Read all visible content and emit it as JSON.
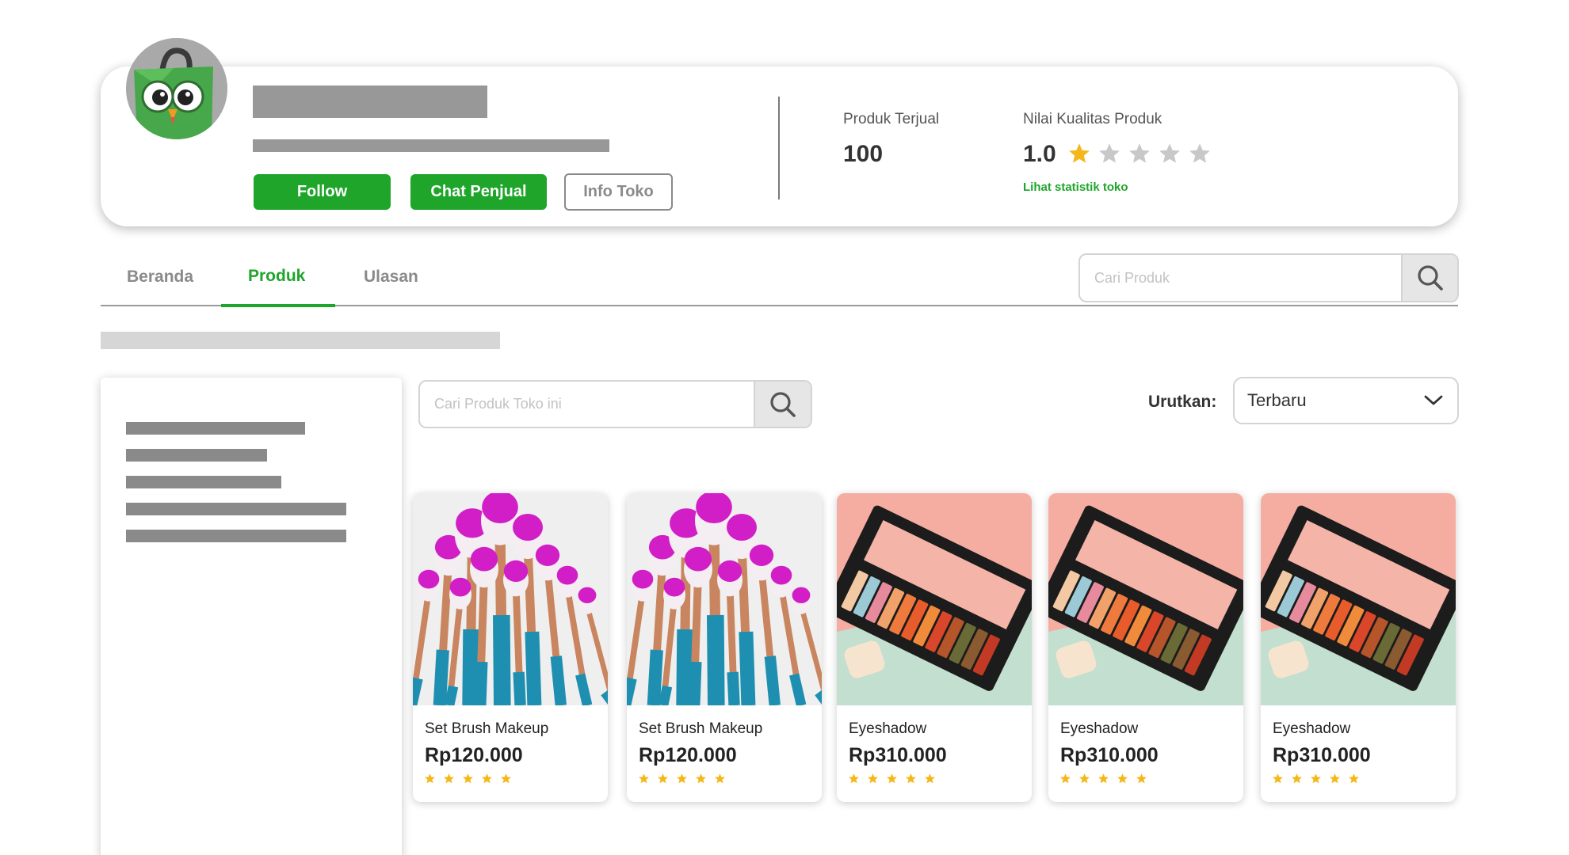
{
  "header": {
    "follow_label": "Follow",
    "chat_label": "Chat Penjual",
    "info_label": "Info Toko",
    "sold_label": "Produk Terjual",
    "sold_value": "100",
    "quality_label": "Nilai Kualitas Produk",
    "quality_value": "1.0",
    "quality_stars_filled": 1,
    "quality_stars_total": 5,
    "stats_link": "Lihat statistik toko"
  },
  "tabs": [
    {
      "label": "Beranda",
      "active": false
    },
    {
      "label": "Produk",
      "active": true
    },
    {
      "label": "Ulasan",
      "active": false
    }
  ],
  "search": {
    "placeholder": "Cari Produk",
    "icon": "search-icon"
  },
  "store_search": {
    "placeholder": "Cari Produk Toko ini",
    "icon": "search-icon"
  },
  "sort": {
    "label": "Urutkan:",
    "value": "Terbaru",
    "icon": "chevron-down-icon"
  },
  "products": [
    {
      "name": "Set Brush Makeup",
      "price": "Rp120.000",
      "rating": 5,
      "image": "makeup-brush-image"
    },
    {
      "name": "Set Brush Makeup",
      "price": "Rp120.000",
      "rating": 5,
      "image": "makeup-brush-image"
    },
    {
      "name": "Eyeshadow",
      "price": "Rp310.000",
      "rating": 5,
      "image": "eyeshadow-palette-image"
    },
    {
      "name": "Eyeshadow",
      "price": "Rp310.000",
      "rating": 5,
      "image": "eyeshadow-palette-image"
    },
    {
      "name": "Eyeshadow",
      "price": "Rp310.000",
      "rating": 5,
      "image": "eyeshadow-palette-image"
    }
  ],
  "colors": {
    "accent": "#1ea52a",
    "star": "#f5b81c",
    "star_empty": "#c8c8c8",
    "placeholder_bar": "#989898"
  }
}
